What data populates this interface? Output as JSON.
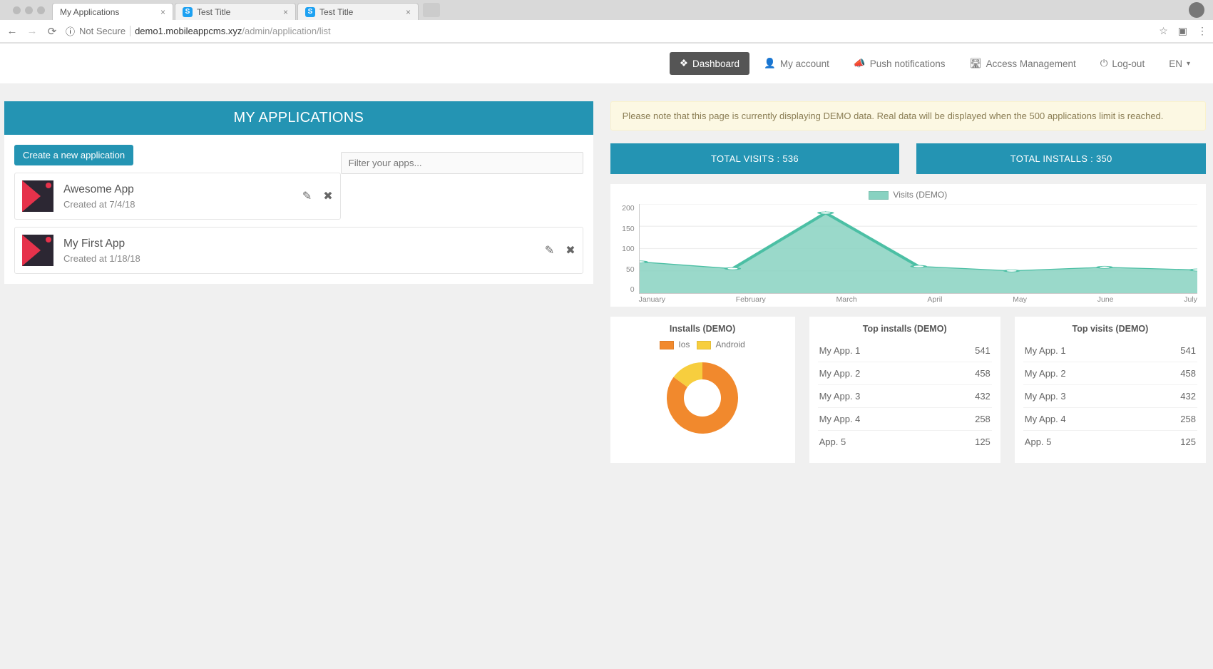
{
  "browser": {
    "tabs": [
      {
        "title": "My Applications",
        "active": true
      },
      {
        "title": "Test Title",
        "active": false,
        "fav": "S"
      },
      {
        "title": "Test Title",
        "active": false,
        "fav": "S"
      }
    ],
    "not_secure": "Not Secure",
    "url_host": "demo1.mobileappcms.xyz",
    "url_path": "/admin/application/list"
  },
  "nav": {
    "dashboard": "Dashboard",
    "my_account": "My account",
    "push": "Push notifications",
    "access": "Access Management",
    "logout": "Log-out",
    "lang": "EN"
  },
  "left": {
    "title": "MY APPLICATIONS",
    "create_btn": "Create a new application",
    "filter_placeholder": "Filter your apps...",
    "apps": [
      {
        "name": "Awesome App",
        "created": "Created at 7/4/18"
      },
      {
        "name": "My First App",
        "created": "Created at 1/18/18"
      }
    ]
  },
  "right": {
    "notice": "Please note that this page is currently displaying DEMO data. Real data will be displayed when the 500 applications limit is reached.",
    "total_visits": "TOTAL VISITS : 536",
    "total_installs": "TOTAL INSTALLS : 350",
    "visits_legend": "Visits (DEMO)",
    "installs_title": "Installs (DEMO)",
    "ios_label": "Ios",
    "android_label": "Android",
    "top_installs_title": "Top installs (DEMO)",
    "top_visits_title": "Top visits (DEMO)",
    "top_installs": [
      {
        "app": "My App. 1",
        "val": "541"
      },
      {
        "app": "My App. 2",
        "val": "458"
      },
      {
        "app": "My App. 3",
        "val": "432"
      },
      {
        "app": "My App. 4",
        "val": "258"
      },
      {
        "app": "App. 5",
        "val": "125"
      }
    ],
    "top_visits": [
      {
        "app": "My App. 1",
        "val": "541"
      },
      {
        "app": "My App. 2",
        "val": "458"
      },
      {
        "app": "My App. 3",
        "val": "432"
      },
      {
        "app": "My App. 4",
        "val": "258"
      },
      {
        "app": "App. 5",
        "val": "125"
      }
    ]
  },
  "chart_data": [
    {
      "type": "area",
      "title": "Visits (DEMO)",
      "categories": [
        "January",
        "February",
        "March",
        "April",
        "May",
        "June",
        "July"
      ],
      "values": [
        70,
        55,
        180,
        60,
        50,
        58,
        52
      ],
      "ylim": [
        0,
        200
      ],
      "yticks": [
        0,
        50,
        100,
        150,
        200
      ],
      "color_fill": "#88d2c1",
      "color_stroke": "#4bbfa4"
    },
    {
      "type": "pie",
      "title": "Installs (DEMO)",
      "series": [
        {
          "name": "Ios",
          "value": 85,
          "color": "#f1892d"
        },
        {
          "name": "Android",
          "value": 15,
          "color": "#f7ce3e"
        }
      ]
    }
  ]
}
